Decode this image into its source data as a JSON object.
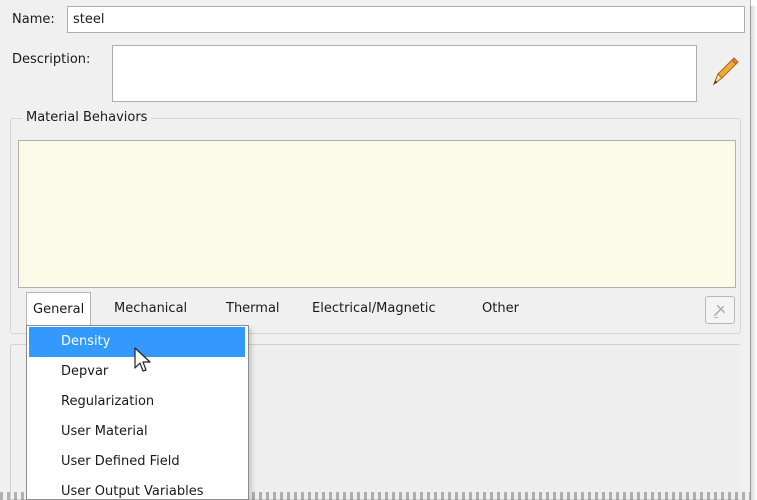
{
  "form": {
    "name_label": "Name:",
    "name_value": "steel",
    "description_label": "Description:",
    "description_value": ""
  },
  "behaviors": {
    "group_title": "Material Behaviors"
  },
  "menubar": {
    "items": [
      {
        "label": "General",
        "underline": "G"
      },
      {
        "label": "Mechanical",
        "underline": "M"
      },
      {
        "label": "Thermal",
        "underline": "T"
      },
      {
        "label": "Electrical/Magnetic",
        "underline": "E"
      },
      {
        "label": "Other",
        "underline": "O"
      }
    ],
    "active": "General"
  },
  "dropdown": {
    "items": [
      {
        "label": "Density",
        "highlighted": true
      },
      {
        "label": "Depvar",
        "highlighted": false
      },
      {
        "label": "Regularization",
        "highlighted": false
      },
      {
        "label": "User Material",
        "highlighted": false
      },
      {
        "label": "User Defined Field",
        "highlighted": false
      },
      {
        "label": "User Output Variables",
        "highlighted": false
      }
    ]
  },
  "colors": {
    "highlight": "#3399ff",
    "behaviors_bg": "#fbfae6",
    "dialog_bg": "#f0f0f0"
  },
  "icons": {
    "edit": "pencil-icon",
    "tool": "delete-behavior-icon",
    "pointer": "mouse-cursor-icon"
  }
}
